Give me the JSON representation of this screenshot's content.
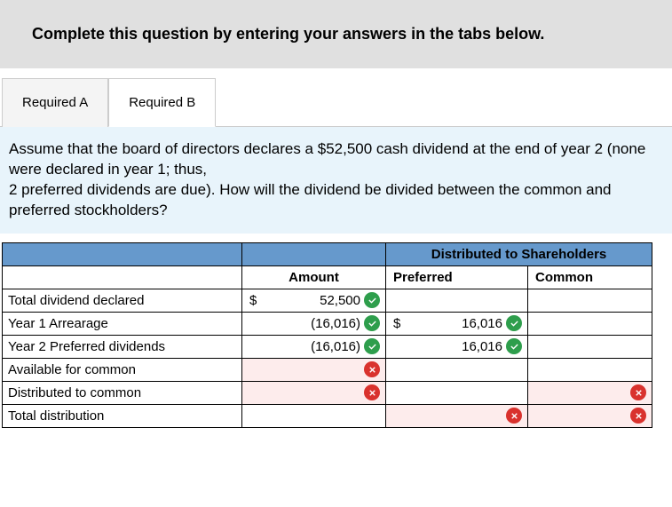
{
  "banner": "Complete this question by entering your answers in the tabs below.",
  "tabs": {
    "a": "Required A",
    "b": "Required B"
  },
  "question": "Assume that the board of directors declares a $52,500 cash dividend at the end of year 2 (none were declared in year 1; thus,\n2 preferred dividends are due). How will the dividend be divided between the common and preferred stockholders?",
  "chart_data": {
    "type": "table",
    "headers": {
      "group": "Distributed to Shareholders",
      "amount": "Amount",
      "preferred": "Preferred",
      "common": "Common"
    },
    "rows": [
      {
        "label": "Total dividend declared",
        "amount": {
          "dollar": "$",
          "value": "52,500",
          "status": "correct"
        },
        "preferred": null,
        "common": null
      },
      {
        "label": "Year 1 Arrearage",
        "amount": {
          "dollar": "",
          "value": "(16,016)",
          "status": "correct"
        },
        "preferred": {
          "dollar": "$",
          "value": "16,016",
          "status": "correct"
        },
        "common": null
      },
      {
        "label": "Year 2 Preferred dividends",
        "amount": {
          "dollar": "",
          "value": "(16,016)",
          "status": "correct"
        },
        "preferred": {
          "dollar": "",
          "value": "16,016",
          "status": "correct"
        },
        "common": null
      },
      {
        "label": "Available for common",
        "amount": {
          "dollar": "",
          "value": "",
          "status": "wrong"
        },
        "preferred": null,
        "common": null
      },
      {
        "label": "Distributed to common",
        "amount": {
          "dollar": "",
          "value": "",
          "status": "wrong"
        },
        "preferred": null,
        "common": {
          "dollar": "",
          "value": "",
          "status": "wrong"
        }
      },
      {
        "label": "Total distribution",
        "amount": null,
        "preferred": {
          "dollar": "",
          "value": "",
          "status": "wrong"
        },
        "common": {
          "dollar": "",
          "value": "",
          "status": "wrong"
        }
      }
    ]
  }
}
